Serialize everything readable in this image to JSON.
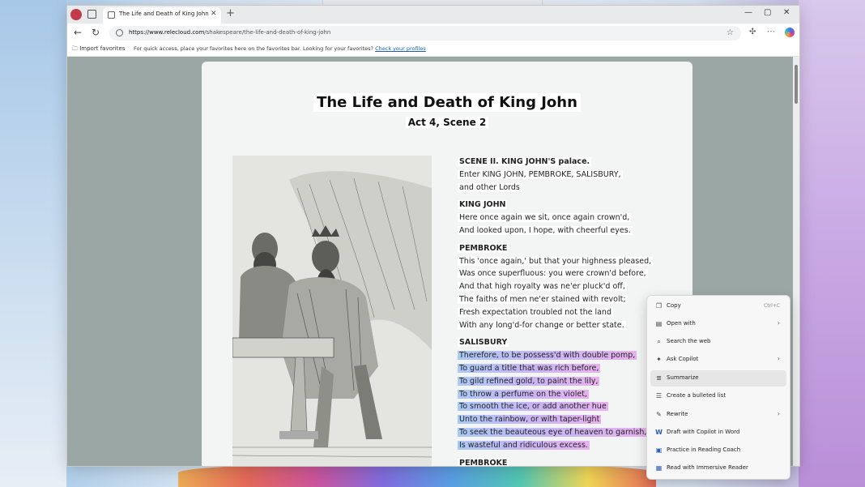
{
  "browser": {
    "tab_title": "The Life and Death of King John",
    "tab_close": "✕",
    "new_tab": "+",
    "url_host": "https://www.relecloud.com",
    "url_path": "/shakespeare/the-life-and-death-of-king-john",
    "window_controls": {
      "minimize": "—",
      "maximize": "▢",
      "close": "✕"
    },
    "nav": {
      "back": "←",
      "refresh": "↻"
    },
    "favorites_bar": {
      "import_label": "Import favorites",
      "message": "For quick access, place your favorites here on the favorites bar. Looking for your favorites?",
      "link": "Check your profiles"
    }
  },
  "document": {
    "title": "The Life and Death of King John",
    "subtitle": "Act 4, Scene 2",
    "scene_heading": "SCENE II. KING JOHN'S palace.",
    "stage_direction": [
      "Enter KING JOHN, PEMBROKE, SALISBURY,",
      "and other Lords"
    ],
    "speeches": [
      {
        "speaker": "KING JOHN",
        "lines": [
          "Here once again we sit, once again crown'd,",
          "And looked upon, I hope, with cheerful eyes."
        ]
      },
      {
        "speaker": "PEMBROKE",
        "lines": [
          "This 'once again,' but that your highness pleased,",
          "Was once superfluous: you were crown'd before,",
          "And that high royalty was ne'er pluck'd off,",
          "The faiths of men ne'er stained with revolt;",
          "Fresh expectation troubled not the land",
          "With any long'd-for change or better state."
        ]
      },
      {
        "speaker": "SALISBURY",
        "lines": [
          "Therefore, to be possess'd with double pomp,",
          "To guard a title that was rich before,",
          "To gild refined gold, to paint the lily,",
          "To throw a perfume on the violet,",
          "To smooth the ice, or add another hue",
          "Unto the rainbow, or with taper-light",
          "To seek the beauteous eye of heaven to garnish,",
          "Is wasteful and ridiculous excess."
        ]
      }
    ],
    "next_speaker_partial": "PEMBROKE"
  },
  "context_menu": {
    "items": [
      {
        "label": "Copy",
        "shortcut": "Ctrl+C",
        "icon": "copy-icon",
        "glyph": "❐"
      },
      {
        "label": "Open with",
        "submenu": "›",
        "icon": "open-with-icon",
        "glyph": "▤"
      },
      {
        "label": "Search the web",
        "icon": "search-icon",
        "glyph": "⌕"
      },
      {
        "label": "Ask Copilot",
        "submenu": "›",
        "icon": "copilot-icon",
        "glyph": "✦"
      },
      {
        "label": "Summarize",
        "icon": "summarize-icon",
        "glyph": "≣"
      },
      {
        "label": "Create a bulleted list",
        "icon": "list-icon",
        "glyph": "☰"
      },
      {
        "label": "Rewrite",
        "submenu": "›",
        "icon": "rewrite-icon",
        "glyph": "✎"
      },
      {
        "label": "Draft with Copilot in Word",
        "icon": "word-icon",
        "glyph": "W"
      },
      {
        "label": "Practice in Reading Coach",
        "icon": "reading-coach-icon",
        "glyph": "▣"
      },
      {
        "label": "Read with Immersive Reader",
        "icon": "immersive-reader-icon",
        "glyph": "▦"
      }
    ],
    "active_item": "Summarize"
  }
}
